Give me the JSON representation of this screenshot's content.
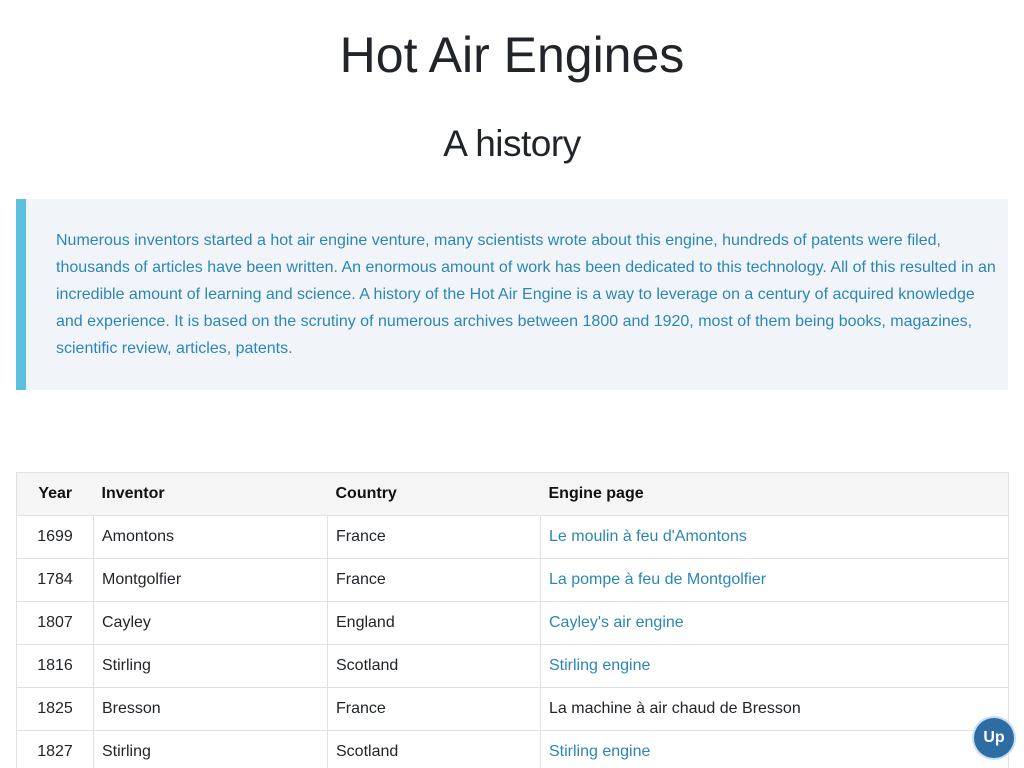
{
  "header": {
    "title": "Hot Air Engines",
    "subtitle": "A history"
  },
  "intro": {
    "text": "Numerous inventors started a hot air engine venture, many scientists wrote about this engine, hundreds of patents were filed, thousands of articles have been written. An enormous amount of work has been dedicated to this technology. All of this resulted in an incredible amount of learning and science. A history of the Hot Air Engine is a way to leverage on a century of acquired knowledge and experience. It is based on the scrutiny of numerous archives between 1800 and 1920, most of them being books, magazines, scientific review, articles, patents."
  },
  "table": {
    "headers": [
      "Year",
      "Inventor",
      "Country",
      "Engine page"
    ],
    "rows": [
      {
        "year": "1699",
        "inventor": "Amontons",
        "country": "France",
        "engine": "Le moulin à feu d'Amontons",
        "is_link": true
      },
      {
        "year": "1784",
        "inventor": "Montgolfier",
        "country": "France",
        "engine": "La pompe à feu de Montgolfier",
        "is_link": true
      },
      {
        "year": "1807",
        "inventor": "Cayley",
        "country": "England",
        "engine": "Cayley's air engine",
        "is_link": true
      },
      {
        "year": "1816",
        "inventor": "Stirling",
        "country": "Scotland",
        "engine": "Stirling engine",
        "is_link": true
      },
      {
        "year": "1825",
        "inventor": "Bresson",
        "country": "France",
        "engine": "La machine à air chaud de Bresson",
        "is_link": false
      },
      {
        "year": "1827",
        "inventor": "Stirling",
        "country": "Scotland",
        "engine": "Stirling engine",
        "is_link": true
      }
    ]
  },
  "up_button": {
    "label": "Up"
  },
  "colors": {
    "accent": "#5bc0de",
    "link": "#2b86b8",
    "callout_bg": "#f1f5f9",
    "up_button_bg": "#2e6da4"
  }
}
